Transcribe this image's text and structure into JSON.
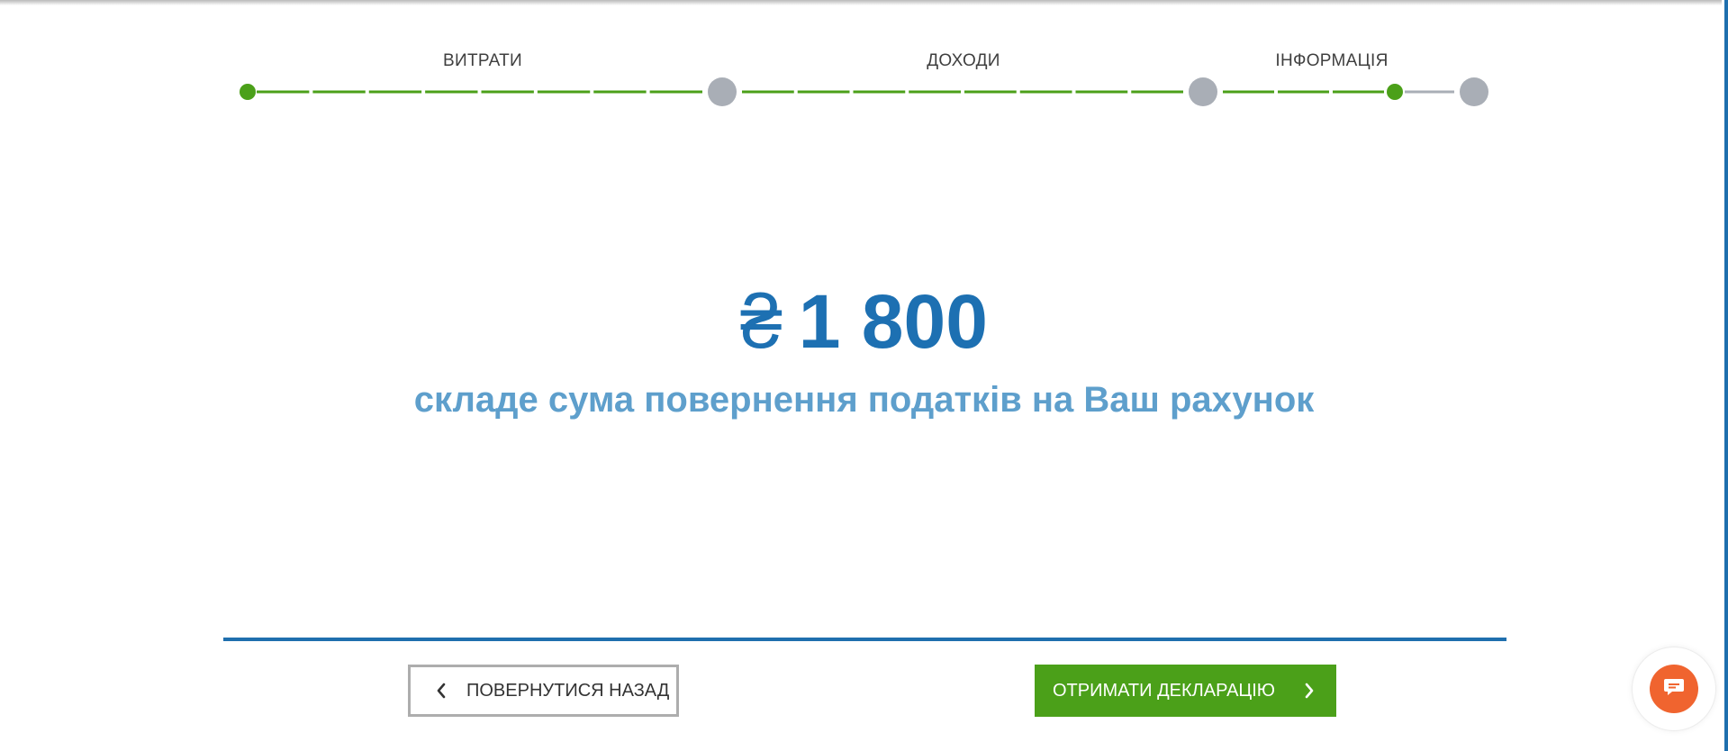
{
  "steps": {
    "labels": [
      "ВИТРАТИ",
      "ДОХОДИ",
      "ІНФОРМАЦІЯ"
    ]
  },
  "progress": {
    "completed_color": "#4ba019",
    "pending_color": "#a9aeb6",
    "current_step": 3
  },
  "result": {
    "currency_symbol": "₴",
    "amount": "1 800",
    "subtitle": "складе сума повернення податків на Ваш рахунок"
  },
  "buttons": {
    "back_label": "ПОВЕРНУТИСЯ НАЗАД",
    "next_label": "ОТРИМАТИ ДЕКЛАРАЦІЮ"
  },
  "chat": {
    "icon": "chat-icon"
  },
  "colors": {
    "primary_blue": "#1d70b2",
    "light_blue": "#5e9fcc",
    "green": "#4ba019",
    "chat_orange": "#f0642f"
  }
}
